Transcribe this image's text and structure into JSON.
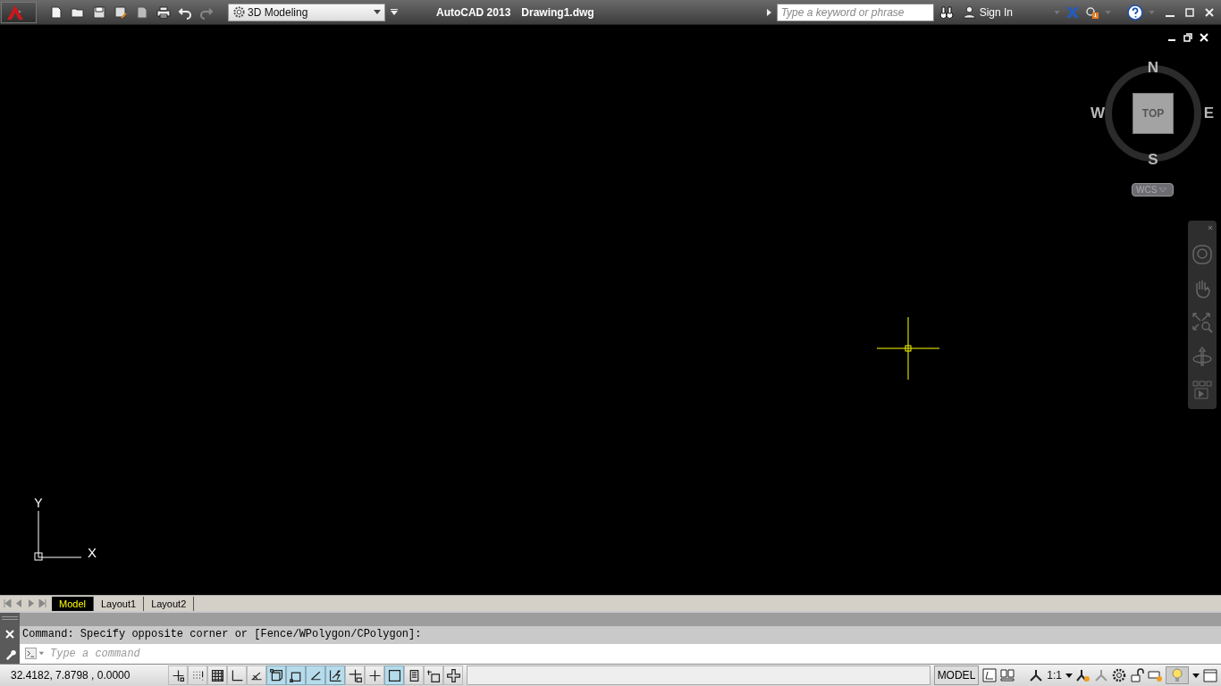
{
  "title_bar": {
    "workspace": "3D Modeling",
    "app_title": "AutoCAD 2013",
    "document": "Drawing1.dwg",
    "search": {
      "placeholder": "Type a keyword or phrase"
    },
    "sign_in": "Sign In"
  },
  "viewcube": {
    "face": "TOP",
    "north": "N",
    "south": "S",
    "east": "E",
    "west": "W",
    "ucs": "WCS"
  },
  "ucs_icon": {
    "x_label": "X",
    "y_label": "Y"
  },
  "layout_tabs": [
    {
      "label": "Model",
      "selected": true
    },
    {
      "label": "Layout1",
      "selected": false
    },
    {
      "label": "Layout2",
      "selected": false
    }
  ],
  "command_line": {
    "history": "Command: Specify opposite corner or [Fence/WPolygon/CPolygon]:",
    "placeholder": "Type a command"
  },
  "status_bar": {
    "coordinates": "32.4182, 7.8798 , 0.0000",
    "toggles": [
      {
        "kind": "infer",
        "on": false
      },
      {
        "kind": "snap",
        "on": false
      },
      {
        "kind": "grid",
        "on": false
      },
      {
        "kind": "ortho",
        "on": false
      },
      {
        "kind": "polar",
        "on": false
      },
      {
        "kind": "osnap3d",
        "on": true
      },
      {
        "kind": "osnap",
        "on": true
      },
      {
        "kind": "otrack",
        "on": true
      },
      {
        "kind": "ducs",
        "on": true
      },
      {
        "kind": "dyn",
        "on": false
      },
      {
        "kind": "lweight",
        "on": false
      },
      {
        "kind": "transparency",
        "on": true
      },
      {
        "kind": "quickprops",
        "on": false
      },
      {
        "kind": "selcycle",
        "on": false
      },
      {
        "kind": "gizmo",
        "on": false
      }
    ],
    "space": "MODEL",
    "annotation_scale": "1:1"
  }
}
